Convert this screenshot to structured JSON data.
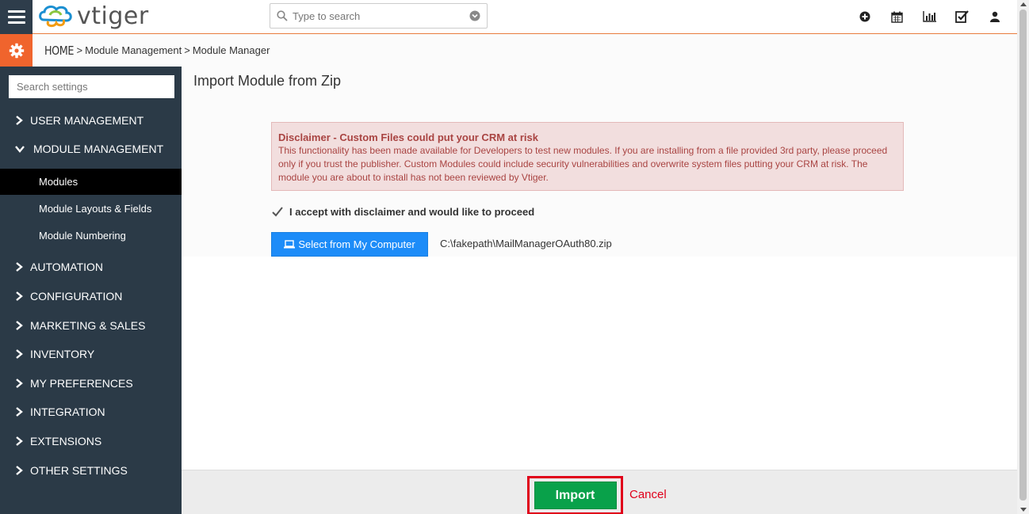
{
  "app": {
    "logo_text": "vtiger"
  },
  "search": {
    "placeholder": "Type to search"
  },
  "top_icons": [
    "plus-circle-icon",
    "calendar-icon",
    "bar-chart-icon",
    "task-check-icon",
    "user-icon"
  ],
  "breadcrumb": {
    "home": "HOME",
    "separator": ">",
    "items": [
      "Module Management",
      "Module Manager"
    ]
  },
  "sidebar": {
    "search_placeholder": "Search settings",
    "items": [
      {
        "label": "USER MANAGEMENT",
        "expanded": false
      },
      {
        "label": "MODULE MANAGEMENT",
        "expanded": true,
        "children": [
          {
            "label": "Modules",
            "active": true
          },
          {
            "label": "Module Layouts & Fields",
            "active": false
          },
          {
            "label": "Module Numbering",
            "active": false
          }
        ]
      },
      {
        "label": "AUTOMATION",
        "expanded": false
      },
      {
        "label": "CONFIGURATION",
        "expanded": false
      },
      {
        "label": "MARKETING & SALES",
        "expanded": false
      },
      {
        "label": "INVENTORY",
        "expanded": false
      },
      {
        "label": "MY PREFERENCES",
        "expanded": false
      },
      {
        "label": "INTEGRATION",
        "expanded": false
      },
      {
        "label": "EXTENSIONS",
        "expanded": false
      },
      {
        "label": "OTHER SETTINGS",
        "expanded": false
      }
    ]
  },
  "main": {
    "title": "Import Module from Zip",
    "disclaimer": {
      "title": "Disclaimer - Custom Files could put your CRM at risk",
      "text": "This functionality has been made available for Developers to test new modules. If you are installing from a file provided 3rd party, please proceed only if you trust the publisher. Custom Modules could include security vulnerabilities and overwrite system files putting your CRM at risk. The module you are about to install has not been reviewed by Vtiger."
    },
    "accept_label": "I accept with disclaimer and would like to proceed",
    "accept_checked": true,
    "select_button": "Select from My Computer",
    "file_name": "C:\\fakepath\\MailManagerOAuth80.zip"
  },
  "footer": {
    "import_label": "Import",
    "cancel_label": "Cancel"
  },
  "colors": {
    "sidebar_bg": "#2b3a47",
    "accent_orange": "#f0642d",
    "select_blue": "#1d8cf8",
    "import_green": "#09a14a",
    "highlight_red": "#e0001a",
    "disclaimer_bg": "#f2dede"
  }
}
